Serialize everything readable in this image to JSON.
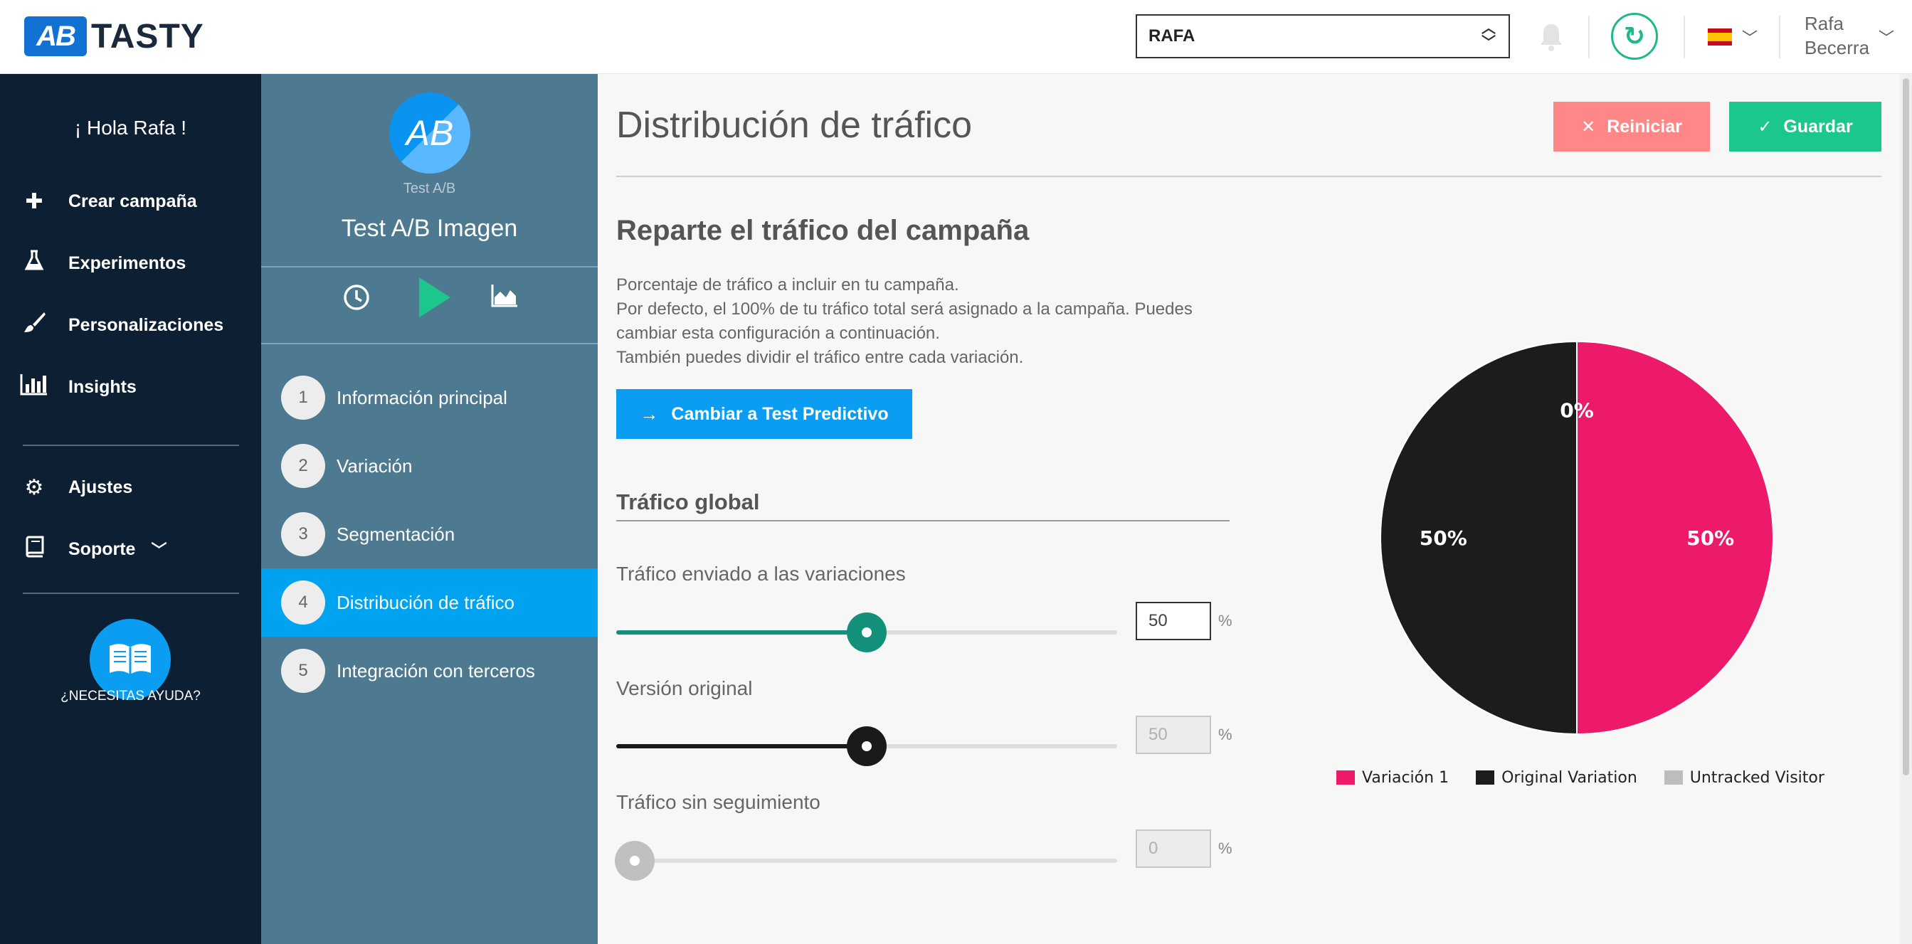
{
  "header": {
    "logo_mark": "AB",
    "logo_text": "TASTY",
    "account_select_value": "RAFA",
    "user_first": "Rafa",
    "user_last": "Becerra"
  },
  "leftnav": {
    "greeting": "¡ Hola Rafa !",
    "items": [
      {
        "label": "Crear campaña",
        "icon": "plus-icon"
      },
      {
        "label": "Experimentos",
        "icon": "flask-icon"
      },
      {
        "label": "Personalizaciones",
        "icon": "brush-icon"
      },
      {
        "label": "Insights",
        "icon": "bar-chart-icon"
      },
      {
        "label": "Ajustes",
        "icon": "gear-icon"
      },
      {
        "label": "Soporte",
        "icon": "book-icon"
      }
    ],
    "help_text": "¿NECESITAS AYUDA?"
  },
  "campaign": {
    "avatar": "AB",
    "type": "Test A/B",
    "name": "Test A/B Imagen",
    "steps": [
      {
        "num": "1",
        "label": "Información principal",
        "active": false
      },
      {
        "num": "2",
        "label": "Variación",
        "active": false
      },
      {
        "num": "3",
        "label": "Segmentación",
        "active": false
      },
      {
        "num": "4",
        "label": "Distribución de tráfico",
        "active": true
      },
      {
        "num": "5",
        "label": "Integración con terceros",
        "active": false
      }
    ]
  },
  "main": {
    "title": "Distribución de tráfico",
    "reset_label": "Reiniciar",
    "save_label": "Guardar",
    "section_title": "Reparte el tráfico del campaña",
    "desc_line1": "Porcentaje de tráfico a incluir en tu campaña.",
    "desc_line2": "Por defecto, el 100% de tu tráfico total será asignado a la campaña. Puedes cambiar esta configuración a continuación.",
    "desc_line3": "También puedes dividir el tráfico entre cada variación.",
    "predictive_label": "Cambiar a Test Predictivo",
    "global_title": "Tráfico global",
    "sliders": [
      {
        "label": "Tráfico enviado a las variaciones",
        "value": 50,
        "value_text": "50",
        "unit": "%",
        "color": "#13907a",
        "disabled": false
      },
      {
        "label": "Versión original",
        "value": 50,
        "value_text": "50",
        "unit": "%",
        "color": "#1a1a1a",
        "disabled": true
      },
      {
        "label": "Tráfico sin seguimiento",
        "value": 0,
        "value_text": "0",
        "unit": "%",
        "color": "#c0c0c0",
        "disabled": true
      }
    ]
  },
  "chart_data": {
    "type": "pie",
    "slices": [
      {
        "name": "Variación 1",
        "value": 50,
        "label": "50%",
        "color": "#ed1a6c"
      },
      {
        "name": "Original Variation",
        "value": 50,
        "label": "50%",
        "color": "#1c1c1c"
      },
      {
        "name": "Untracked Visitor",
        "value": 0,
        "label": "0%",
        "color": "#bdbdbd"
      }
    ],
    "legend_position": "bottom"
  },
  "colors": {
    "accent_blue": "#0a9df2",
    "save_green": "#1cc78e",
    "reset_red": "#ff8787",
    "nav_dark": "#0d1f33",
    "panel_teal": "#4d7a90"
  }
}
